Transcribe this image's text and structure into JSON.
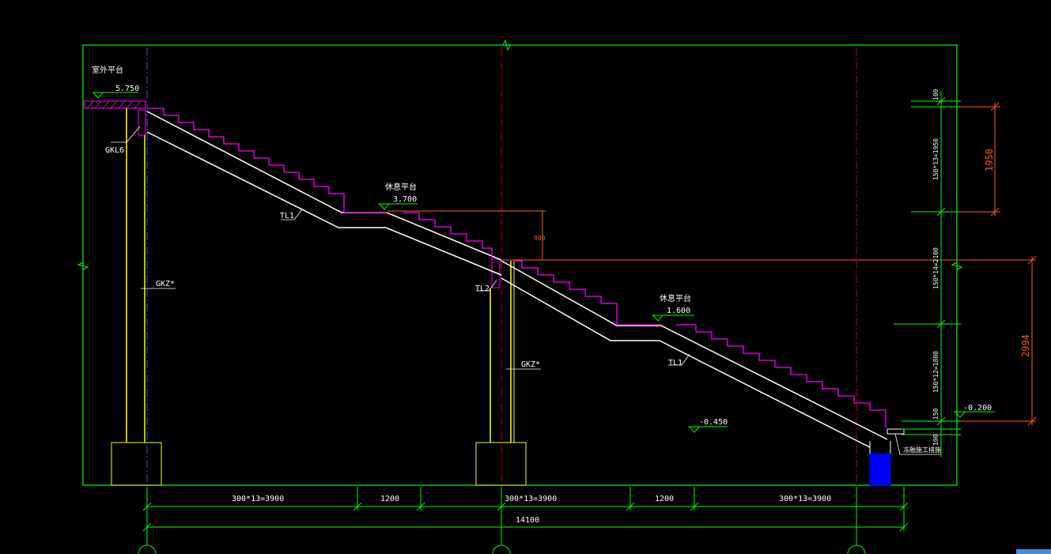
{
  "colors": {
    "background": "#000000",
    "frame": "#00ff00",
    "stair": "#ffffff",
    "steps": "#ff00ff",
    "column": "#ffff00",
    "axis": "#c00000",
    "dimension": "#ff5a1e",
    "base": "#0000ff"
  },
  "levels": {
    "top_title": "室外平台",
    "top": "5.750",
    "mid_title": "休息平台",
    "mid": "3.700",
    "low_title": "休息平台",
    "low": "1.600",
    "ground": "-0.450",
    "entry": "-0.200"
  },
  "labels": {
    "beam": "GKL6",
    "column_left": "GKZ*",
    "column_mid": "GKZ*",
    "tl1_upper": "TL1",
    "tl2": "TL2",
    "tl1_lower": "TL1",
    "foot_note": "冻融施工措施",
    "mid_riser": "900"
  },
  "dims_bottom": [
    "300*13=3900",
    "1200",
    "300*13=3900",
    "1200",
    "300*13=3900"
  ],
  "dim_total": "14100",
  "dims_right_inner": [
    "100",
    "150*13=1950",
    "150*14=2100",
    "150*12=1800",
    "150",
    "100"
  ],
  "dims_right_outer": [
    "1950",
    "2994"
  ]
}
